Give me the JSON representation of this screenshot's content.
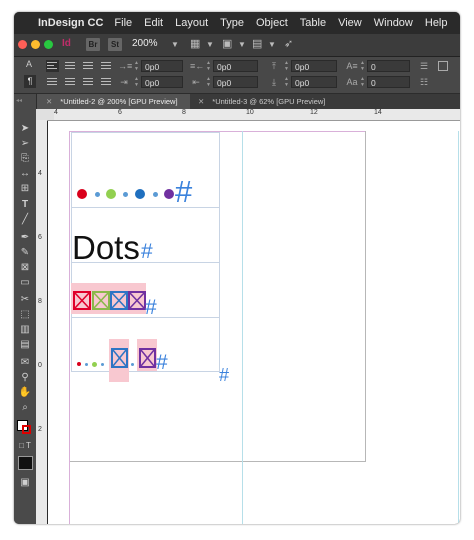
{
  "menubar": {
    "app_name": "InDesign CC",
    "items": [
      "File",
      "Edit",
      "Layout",
      "Type",
      "Object",
      "Table",
      "View",
      "Window",
      "Help"
    ]
  },
  "appbar": {
    "app_logo": "Id",
    "bridge_label": "Br",
    "stock_label": "St",
    "zoom": "200%"
  },
  "control": {
    "fields": [
      "0p0",
      "0p0",
      "0p0",
      "0p0",
      "0p0",
      "0p0",
      "0",
      "0"
    ],
    "char_icon": "A",
    "para_icon": "¶"
  },
  "tabs": [
    {
      "label": "*Untitled-2 @ 200% [GPU Preview]",
      "active": true
    },
    {
      "label": "*Untitled-3 @ 62% [GPU Preview]",
      "active": false
    }
  ],
  "ruler": {
    "h_labels": [
      "4",
      "6",
      "8",
      "10",
      "12",
      "14"
    ],
    "v_labels": [
      "4",
      "6",
      "8",
      "0",
      "2"
    ]
  },
  "document": {
    "dots_text": "Dots",
    "hash": "#",
    "accent": "#3b82dc",
    "dot_colors": [
      "#d9001b",
      "#5b9bd5",
      "#92d050",
      "#5b9bd5",
      "#1f6fbf",
      "#5b9bd5",
      "#7030a0"
    ],
    "frame_colors": [
      "#e0002a",
      "#8ab84a",
      "#2e75c4",
      "#7030a0"
    ],
    "highlight": "#f8c8d0"
  },
  "icons": [
    "apple-icon",
    "selection-tool-icon",
    "direct-selection-icon",
    "type-tool-icon",
    "pen-tool-icon",
    "rectangle-frame-icon",
    "scissors-icon",
    "hand-icon",
    "zoom-icon",
    "close-icon"
  ]
}
